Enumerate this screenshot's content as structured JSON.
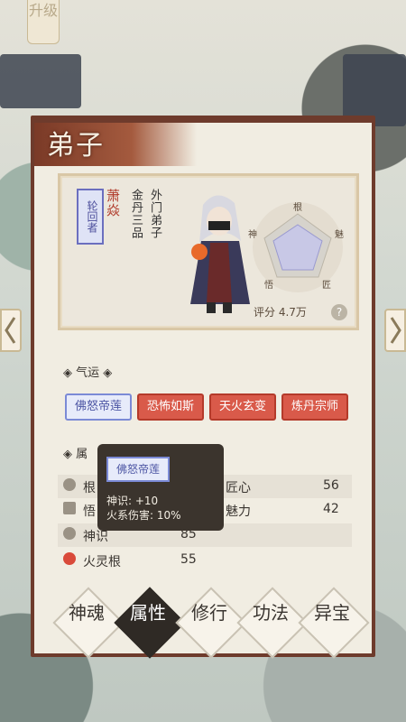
{
  "upgrade_label": "升级",
  "panel_title": "弟子",
  "disciple": {
    "tag": "轮回者",
    "name": "萧焱",
    "realm": "金丹三品",
    "rank": "外门弟子",
    "score_label": "评分 4.7万",
    "radar_labels": [
      "根",
      "魅",
      "匠",
      "悟",
      "神"
    ]
  },
  "fortune": {
    "title": "◈ 气运 ◈",
    "chips": [
      {
        "label": "佛怒帝莲",
        "style": "blue"
      },
      {
        "label": "恐怖如斯",
        "style": "red"
      },
      {
        "label": "天火玄变",
        "style": "red"
      },
      {
        "label": "炼丹宗师",
        "style": "red"
      }
    ]
  },
  "attributes": {
    "title": "◈ 属",
    "rows": [
      {
        "left_label": "根",
        "left_value": "",
        "right_label": "匠心",
        "right_value": "56"
      },
      {
        "left_label": "悟",
        "left_value": "",
        "right_label": "魅力",
        "right_value": "42"
      },
      {
        "left_label": "神识",
        "left_value": "85",
        "right_label": "",
        "right_value": ""
      },
      {
        "left_label": "火灵根",
        "left_value": "55",
        "right_label": "",
        "right_value": ""
      }
    ]
  },
  "tooltip": {
    "tag": "佛怒帝莲",
    "line1": "神识: +10",
    "line2": "火系伤害: 10%"
  },
  "tabs": [
    "神魂",
    "属性",
    "修行",
    "功法",
    "异宝"
  ],
  "colors": {
    "accent": "#7a3a27",
    "chip_red": "#d95a4a",
    "chip_blue": "#7b8ad6"
  }
}
